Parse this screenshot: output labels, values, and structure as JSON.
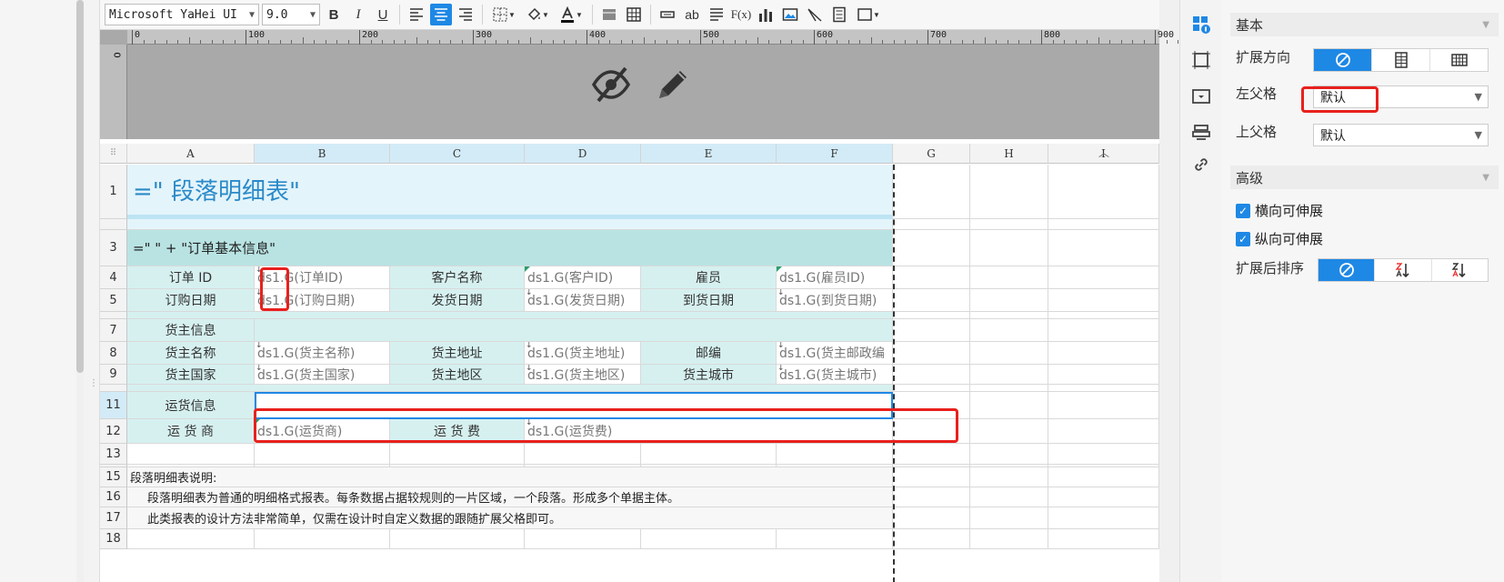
{
  "toolbar": {
    "font_family": "Microsoft YaHei UI",
    "font_size": "9.0",
    "bold": "B",
    "italic": "I",
    "underline": "U",
    "text_ab": "ab",
    "formula": "F(x)"
  },
  "ruler": {
    "ticks": [
      "0",
      "100",
      "200",
      "300",
      "400",
      "500",
      "600",
      "700",
      "800",
      "900"
    ],
    "vertical_zero": "0"
  },
  "columns": [
    "A",
    "B",
    "C",
    "D",
    "E",
    "F",
    "G",
    "H",
    "I"
  ],
  "rows": {
    "r1": "1",
    "r3": "3",
    "r4": "4",
    "r5": "5",
    "r7": "7",
    "r8": "8",
    "r9": "9",
    "r11": "11",
    "r12": "12",
    "r13": "13",
    "r15": "15",
    "r16": "16",
    "r17": "17",
    "r18": "18"
  },
  "cells": {
    "title": "=\"  段落明细表\"",
    "order_info": "=\"    \" + \"订单基本信息\"",
    "order_id_label": "订单  ID",
    "order_id_val": "ds1.G(订单ID)",
    "customer_label": "客户名称",
    "customer_val": "ds1.G(客户ID)",
    "employee_label": "雇员",
    "employee_val": "ds1.G(雇员ID)",
    "order_date_label": "订购日期",
    "order_date_val": "ds1.G(订购日期)",
    "ship_date_label": "发货日期",
    "ship_date_val": "ds1.G(发货日期)",
    "arrive_date_label": "到货日期",
    "arrive_date_val": "ds1.G(到货日期)",
    "shipper_info": "货主信息",
    "shipper_name_label": "货主名称",
    "shipper_name_val": "ds1.G(货主名称)",
    "shipper_addr_label": "货主地址",
    "shipper_addr_val": "ds1.G(货主地址)",
    "zip_label": "邮编",
    "zip_val": "ds1.G(货主邮政编",
    "shipper_country_label": "货主国家",
    "shipper_country_val": "ds1.G(货主国家)",
    "shipper_region_label": "货主地区",
    "shipper_region_val": "ds1.G(货主地区)",
    "shipper_city_label": "货主城市",
    "shipper_city_val": "ds1.G(货主城市)",
    "freight_info": "运货信息",
    "carrier_label": "运 货 商",
    "carrier_val": "ds1.G(运货商)",
    "freight_label": "运 货 费",
    "freight_val": "ds1.G(运货费)",
    "note_title": "段落明细表说明:",
    "note_1": "段落明细表为普通的明细格式报表。每条数据占据较规则的一片区域，一个段落。形成多个单据主体。",
    "note_2": "此类报表的设计方法非常简单，仅需在设计时自定义数据的跟随扩展父格即可。"
  },
  "panel": {
    "basic_header": "基本",
    "expand_direction_label": "扩展方向",
    "left_parent_label": "左父格",
    "left_parent_value": "默认",
    "top_parent_label": "上父格",
    "top_parent_value": "默认",
    "advanced_header": "高级",
    "horizontal_expand": "横向可伸展",
    "vertical_expand": "纵向可伸展",
    "sort_after_expand_label": "扩展后排序"
  },
  "colors": {
    "accent": "#1e88e5",
    "label_cell_bg": "#d6f0f0",
    "title_cell_bg": "#e4f4fb",
    "highlight_red": "#e8201d"
  }
}
